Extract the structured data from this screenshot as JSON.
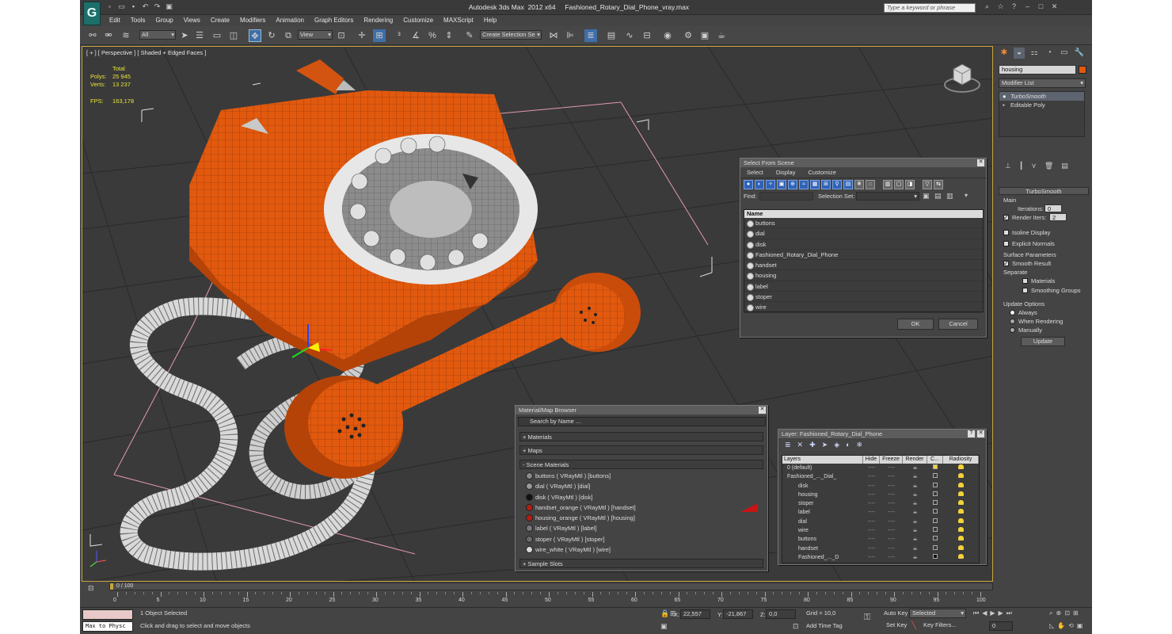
{
  "app": {
    "title": "Autodesk 3ds Max  2012 x64     Fashioned_Rotary_Dial_Phone_vray.max",
    "search_placeholder": "Type a keyword or phrase",
    "logo": "3ds-max-logo"
  },
  "menu": [
    "Edit",
    "Tools",
    "Group",
    "Views",
    "Create",
    "Modifiers",
    "Animation",
    "Graph Editors",
    "Rendering",
    "Customize",
    "MAXScript",
    "Help"
  ],
  "toolbar": {
    "filter": "All",
    "coord": "View",
    "selection_set": "Create Selection Se"
  },
  "viewport": {
    "label": "[ + ] [ Perspective ] [ Shaded + Edged Faces ]",
    "stats": {
      "header": "Total",
      "polys_label": "Polys:",
      "polys": "25 945",
      "verts_label": "Verts:",
      "verts": "13 237",
      "fps_label": "FPS:",
      "fps": "163,178"
    }
  },
  "command_panel": {
    "name_field": "housing",
    "modifier_list": "Modifier List",
    "stack": [
      "TurboSmooth",
      "Editable Poly"
    ],
    "turbosmooth": {
      "title": "TurboSmooth",
      "main": "Main",
      "iterations_label": "Iterations:",
      "iterations": "0",
      "render_iters_label": "Render Iters:",
      "render_iters": "2",
      "isoline": "Isoline Display",
      "explicit": "Explicit Normals",
      "surface": "Surface Parameters",
      "smooth_result": "Smooth Result",
      "separate": "Separate",
      "materials": "Materials",
      "smoothing_groups": "Smoothing Groups",
      "update_options": "Update Options",
      "always": "Always",
      "when_rendering": "When Rendering",
      "manually": "Manually",
      "update": "Update"
    }
  },
  "select_from_scene": {
    "title": "Select From Scene",
    "menu": [
      "Select",
      "Display",
      "Customize"
    ],
    "find_label": "Find:",
    "selection_set_label": "Selection Set:",
    "column": "Name",
    "items": [
      "buttons",
      "dial",
      "disk",
      "Fashioned_Rotary_Dial_Phone",
      "handset",
      "housing",
      "label",
      "stoper",
      "wire"
    ],
    "ok": "OK",
    "cancel": "Cancel"
  },
  "material_browser": {
    "title": "Material/Map Browser",
    "search": "Search by Name ...",
    "materials": "+ Materials",
    "maps": "+ Maps",
    "scene_materials": "- Scene Materials",
    "items": [
      {
        "name": "buttons  ( VRayMtl ) [buttons]",
        "color": "#8a8a8a"
      },
      {
        "name": "dial  ( VRayMtl ) [dial]",
        "color": "#9a9a9a"
      },
      {
        "name": "disk  ( VRayMtl ) [disk]",
        "color": "#111111"
      },
      {
        "name": "handset_orange  ( VRayMtl ) [handset]",
        "color": "#b51d12"
      },
      {
        "name": "housing_orange  ( VRayMtl ) [housing]",
        "color": "#b51d12"
      },
      {
        "name": "label  ( VRayMtl ) [label]",
        "color": "#777777"
      },
      {
        "name": "stoper  ( VRayMtl ) [stoper]",
        "color": "#6a6a6a"
      },
      {
        "name": "wire_white  ( VRayMtl ) [wire]",
        "color": "#d8d8d8"
      }
    ],
    "sample_slots": "+ Sample Slots"
  },
  "layer_manager": {
    "title": "Layer: Fashioned_Rotary_Dial_Phone",
    "columns": [
      "Layers",
      "Hide",
      "Freeze",
      "Render",
      "C...",
      "Radiosity"
    ],
    "rows": [
      "0 (default)",
      "Fashioned_..._Dial_",
      "disk",
      "housing",
      "stoper",
      "label",
      "dial",
      "wire",
      "buttons",
      "handset",
      "Fashioned_..._D"
    ],
    "placeholder": "----"
  },
  "timeline": {
    "frame": "0 / 100",
    "ticks": [
      "0",
      "5",
      "10",
      "15",
      "20",
      "25",
      "30",
      "35",
      "40",
      "45",
      "50",
      "55",
      "60",
      "65",
      "70",
      "75",
      "80",
      "85",
      "90",
      "95",
      "100"
    ]
  },
  "status": {
    "selected": "1 Object Selected",
    "prompt": "Click and drag to select and move objects",
    "script": "Max to Physc",
    "x_label": "X:",
    "x": "22,557",
    "y_label": "Y:",
    "y": "-21,867",
    "z_label": "Z:",
    "z": "0,0",
    "grid": "Grid = 10,0",
    "add_time_tag": "Add Time Tag",
    "auto_key": "Auto Key",
    "set_key": "Set Key",
    "key_mode": "Selected",
    "key_filters": "Key Filters...",
    "frame": "0"
  }
}
